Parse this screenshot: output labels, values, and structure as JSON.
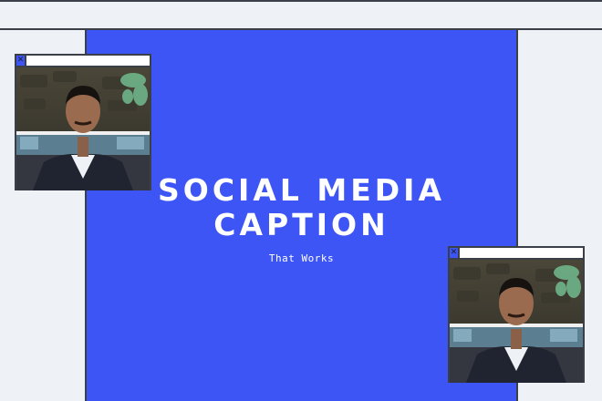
{
  "headline": {
    "line1": "SOCIAL MEDIA",
    "line2": "CAPTION"
  },
  "subhead": "That Works",
  "photo_windows": [
    {
      "close_icon": "close-icon",
      "close_glyph": "✕"
    },
    {
      "close_icon": "close-icon",
      "close_glyph": "✕"
    }
  ],
  "colors": {
    "accent_blue": "#3d55f5",
    "page_bg": "#eef1f5",
    "outline": "#3b3f48",
    "text": "#ffffff"
  }
}
